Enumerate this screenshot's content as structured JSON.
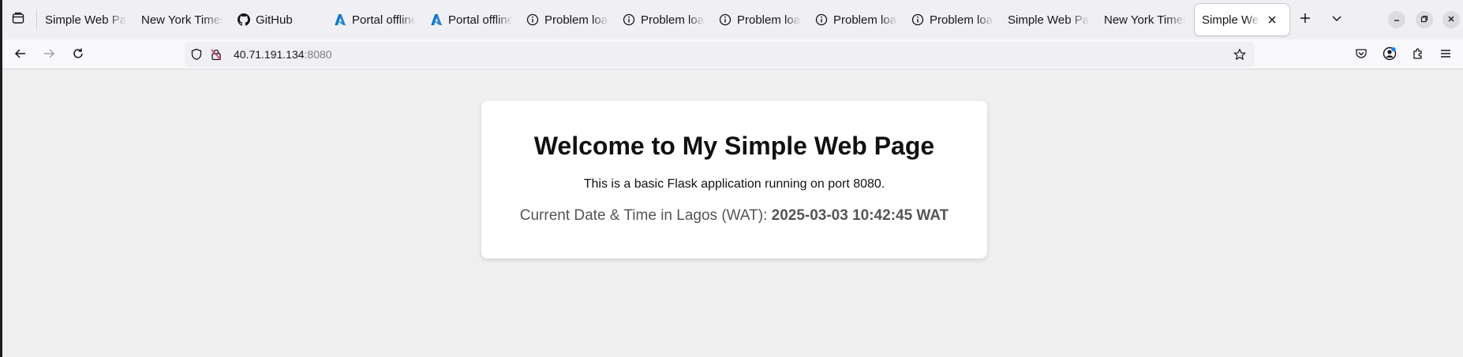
{
  "browser": {
    "tabs": [
      {
        "title": "Simple Web Page",
        "favicon": "none",
        "active": false
      },
      {
        "title": "New York Times",
        "favicon": "none",
        "active": false
      },
      {
        "title": "GitHub",
        "favicon": "github-icon",
        "active": false
      },
      {
        "title": "Portal offline",
        "favicon": "azure-icon",
        "active": false
      },
      {
        "title": "Portal offline",
        "favicon": "azure-icon",
        "active": false
      },
      {
        "title": "Problem loading page",
        "favicon": "info-icon",
        "active": false
      },
      {
        "title": "Problem loading page",
        "favicon": "info-icon",
        "active": false
      },
      {
        "title": "Problem loading page",
        "favicon": "info-icon",
        "active": false
      },
      {
        "title": "Problem loading page",
        "favicon": "info-icon",
        "active": false
      },
      {
        "title": "Problem loading page",
        "favicon": "info-icon",
        "active": false
      },
      {
        "title": "Simple Web Page",
        "favicon": "none",
        "active": false
      },
      {
        "title": "New York Times",
        "favicon": "none",
        "active": false
      },
      {
        "title": "Simple Web Page",
        "favicon": "none",
        "active": true
      }
    ],
    "url": {
      "host": "40.71.191.134",
      "port": ":8080"
    },
    "colors": {
      "azure": "#0078d4",
      "extension_dot": "#0a84ff"
    }
  },
  "page": {
    "heading": "Welcome to My Simple Web Page",
    "description": "This is a basic Flask application running on port 8080.",
    "time_label": "Current Date & Time in Lagos (WAT): ",
    "time_value": "2025-03-03 10:42:45 WAT"
  }
}
